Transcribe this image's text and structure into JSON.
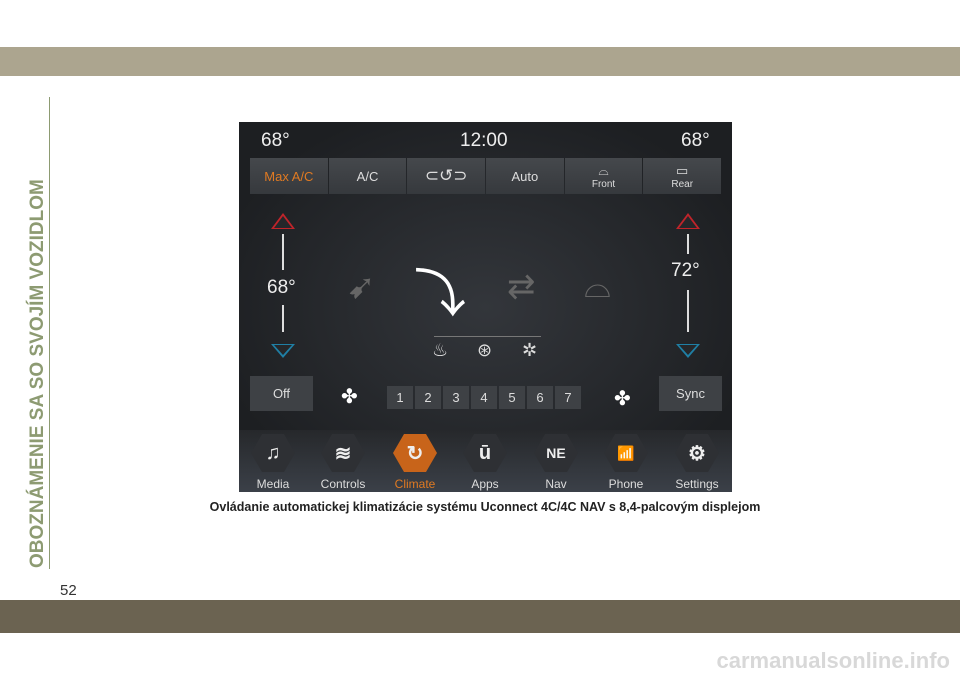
{
  "sidebar": {
    "section_title": "OBOZNÁMENIE SA SO SVOJÍM VOZIDLOM",
    "page_number": "52"
  },
  "caption": "Ovládanie automatickej klimatizácie systému Uconnect 4C/4C NAV s 8,4-palcovým displejom",
  "watermark": "carmanualsonline.info",
  "screen": {
    "status": {
      "left_temp": "68°",
      "clock": "12:00",
      "right_temp": "68°"
    },
    "top_buttons": [
      {
        "label": "Max A/C",
        "active": true,
        "color": "#e07a22"
      },
      {
        "label": "A/C"
      },
      {
        "icon": "recirculation-icon"
      },
      {
        "label": "Auto"
      },
      {
        "icon": "front-defrost-icon",
        "label": "Front"
      },
      {
        "icon": "rear-defrost-icon",
        "label": "Rear"
      }
    ],
    "driver_temp": "68°",
    "passenger_temp": "72°",
    "modes": [
      "panel-mode-icon",
      "floor-mode-icon",
      "bilevel-mode-icon",
      "mix-mode-icon",
      "defrost-floor-mode-icon"
    ],
    "seat_controls": [
      "heated-seat-icon",
      "heated-steering-wheel-icon",
      "ventilated-seat-icon"
    ],
    "off_label": "Off",
    "sync_label": "Sync",
    "fan_speeds": [
      "1",
      "2",
      "3",
      "4",
      "5",
      "6",
      "7"
    ],
    "nav": [
      {
        "label": "Media",
        "icon": "♫"
      },
      {
        "label": "Controls",
        "icon": "≋"
      },
      {
        "label": "Climate",
        "icon": "↻",
        "active": true
      },
      {
        "label": "Apps",
        "icon": "ū"
      },
      {
        "label": "Nav",
        "icon": "NE"
      },
      {
        "label": "Phone",
        "icon": "📶"
      },
      {
        "label": "Settings",
        "icon": "⚙"
      }
    ],
    "colors": {
      "accent": "#e07a22",
      "temp_up": "#c0242a",
      "temp_down": "#1f7fa5"
    }
  }
}
